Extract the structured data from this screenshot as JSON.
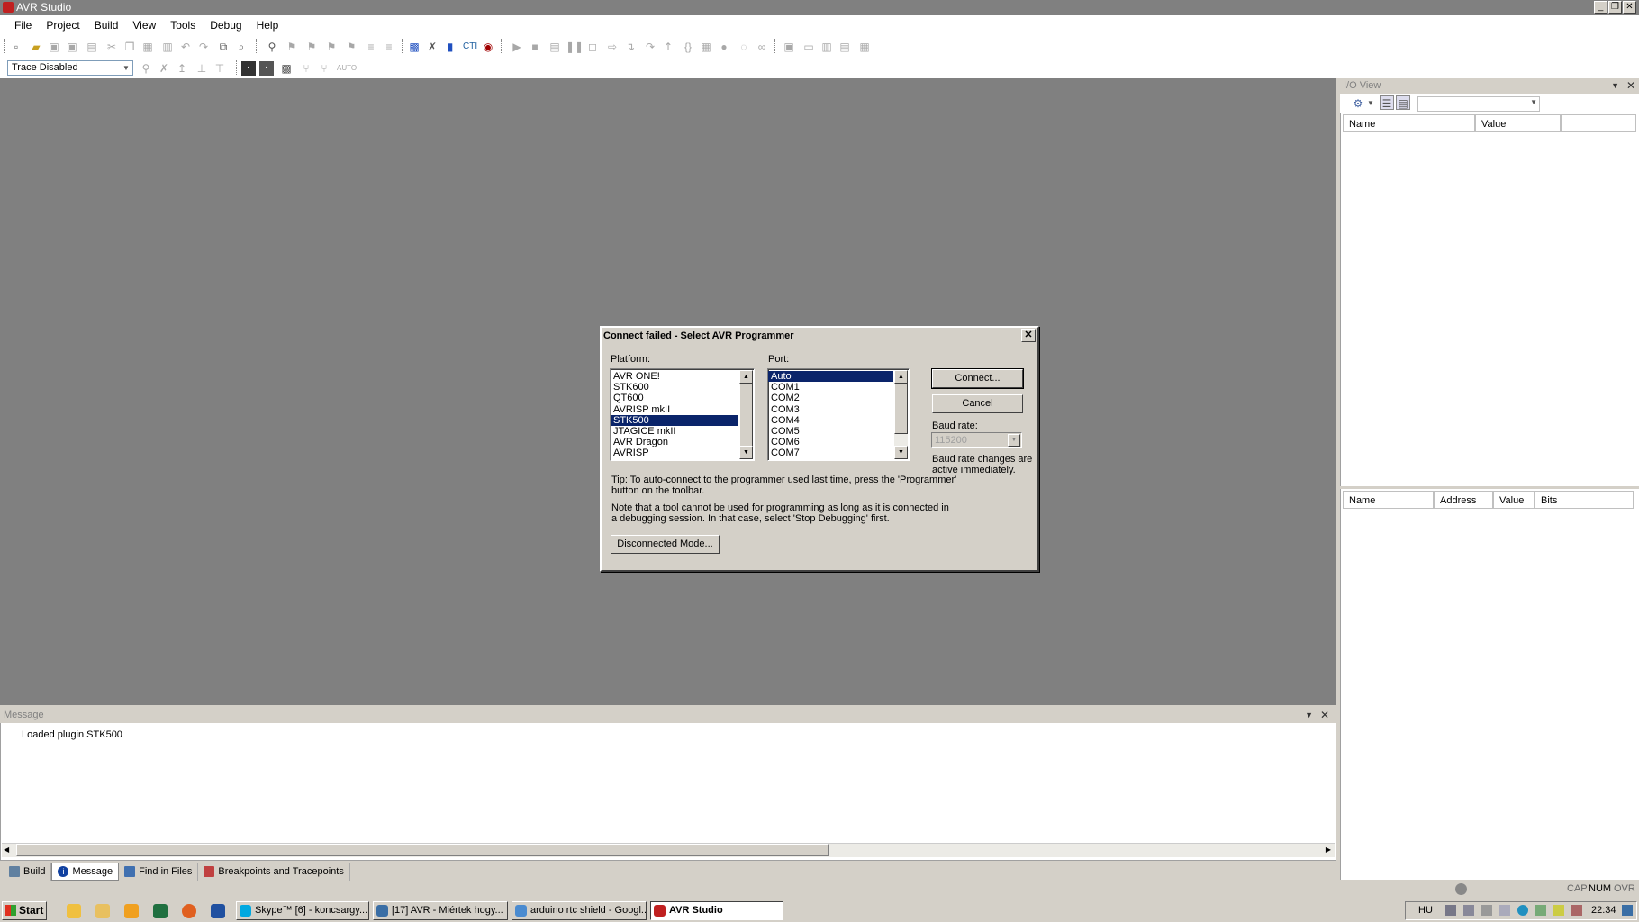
{
  "window": {
    "title": "AVR Studio",
    "controls": {
      "minimize": "_",
      "restore": "❐",
      "close": "✕"
    }
  },
  "menu": [
    "File",
    "Project",
    "Build",
    "View",
    "Tools",
    "Debug",
    "Help"
  ],
  "toolbar2": {
    "trace_select": "Trace Disabled"
  },
  "message_panel": {
    "title": "Message",
    "lines": [
      "Loaded plugin STK500"
    ]
  },
  "bottom_tabs": [
    {
      "label": "Build",
      "icon": "build-icon"
    },
    {
      "label": "Message",
      "icon": "info-icon"
    },
    {
      "label": "Find in Files",
      "icon": "find-in-files-icon"
    },
    {
      "label": "Breakpoints and Tracepoints",
      "icon": "breakpoints-icon"
    }
  ],
  "io_view": {
    "title": "I/O View",
    "top_columns": [
      "Name",
      "Value"
    ],
    "bottom_columns": [
      "Name",
      "Address",
      "Value",
      "Bits"
    ]
  },
  "status": {
    "cap": "CAP",
    "num": "NUM",
    "ovr": "OVR"
  },
  "dialog": {
    "title": "Connect failed - Select AVR Programmer",
    "platform_label": "Platform:",
    "platforms": [
      "AVR ONE!",
      "STK600",
      "QT600",
      "AVRISP mkII",
      "STK500",
      "JTAGICE mkII",
      "AVR Dragon",
      "AVRISP"
    ],
    "platform_selected": "STK500",
    "port_label": "Port:",
    "ports": [
      "Auto",
      "COM1",
      "COM2",
      "COM3",
      "COM4",
      "COM5",
      "COM6",
      "COM7"
    ],
    "port_selected": "Auto",
    "connect_button": "Connect...",
    "cancel_button": "Cancel",
    "baud_label": "Baud rate:",
    "baud_value": "115200",
    "baud_note_1": "Baud rate changes are",
    "baud_note_2": "active immediately.",
    "tip_1": "Tip: To auto-connect to the programmer used last time, press the 'Programmer'",
    "tip_2": "button on the toolbar.",
    "note_1": "Note that a tool cannot be used for programming as long as it is connected in",
    "note_2": "a debugging session. In that case, select 'Stop Debugging' first.",
    "disconnected_button": "Disconnected Mode..."
  },
  "taskbar": {
    "start": "Start",
    "tasks": [
      {
        "label": "Skype™ [6] - koncsargy...",
        "color": "#00a8e0"
      },
      {
        "label": "[17] AVR - Miértek hogy...",
        "color": "#3a6ea5"
      },
      {
        "label": "arduino rtc shield - Googl...",
        "color": "#4a8bd0"
      },
      {
        "label": "AVR Studio",
        "color": "#c02020"
      }
    ],
    "lang": "HU",
    "clock": "22:34"
  }
}
